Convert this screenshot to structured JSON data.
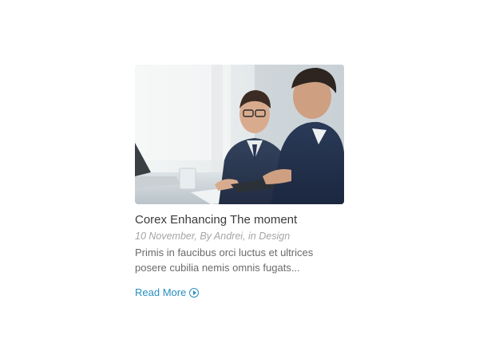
{
  "post": {
    "image_description": "two-businessmen-photo",
    "title": "Corex Enhancing The moment",
    "meta": {
      "date": "10 November",
      "author_prefix": "By",
      "author": "Andrei",
      "category_prefix": "in",
      "category": "Design"
    },
    "excerpt": "Primis in faucibus orci luctus et ultrices posere cubilia nemis omnis fugats...",
    "read_more_label": "Read More",
    "read_more_icon": "play-circle-icon"
  },
  "colors": {
    "title": "#3a3a3a",
    "meta": "#a5a5a5",
    "excerpt": "#6a6a6a",
    "link": "#2a8fc1"
  }
}
